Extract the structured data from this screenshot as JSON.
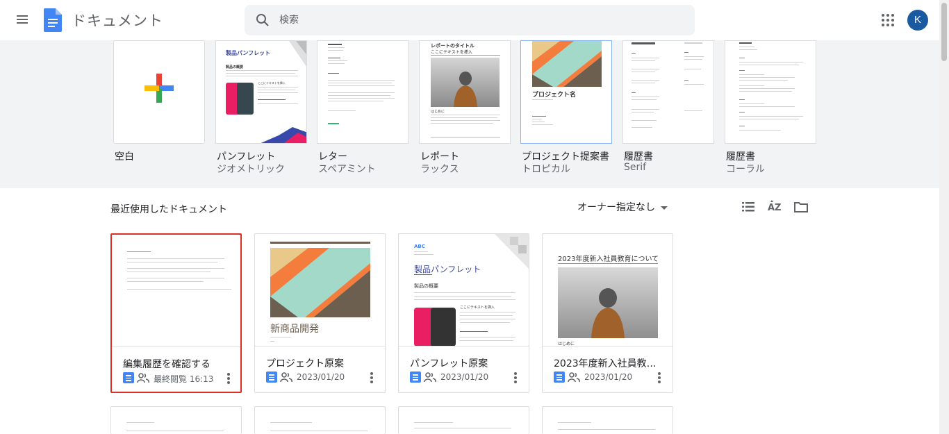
{
  "header": {
    "app_title": "ドキュメント",
    "search_placeholder": "検索",
    "avatar_letter": "K"
  },
  "templates": [
    {
      "name": "空白",
      "sub": ""
    },
    {
      "name": "パンフレット",
      "sub": "ジオメトリック",
      "thumb_title": "製品パンフレット",
      "thumb_sub": "製品の概要",
      "thumb_callout": "ここにテキストを挿入"
    },
    {
      "name": "レター",
      "sub": "スペアミント"
    },
    {
      "name": "レポート",
      "sub": "ラックス",
      "thumb_title": "レポートのタイトル",
      "thumb_sub": "ここにテキストを挿入",
      "thumb_section": "はじめに"
    },
    {
      "name": "プロジェクト提案書",
      "sub": "トロピカル",
      "thumb_title": "プロジェクト名"
    },
    {
      "name": "履歴書",
      "sub": "Serif"
    },
    {
      "name": "履歴書",
      "sub": "コーラル"
    }
  ],
  "recent": {
    "title": "最近使用したドキュメント",
    "owner_filter": "オーナー指定なし"
  },
  "cards": [
    {
      "title": "編集履歴を確認する",
      "date": "最終閲覧 16:13"
    },
    {
      "title": "プロジェクト原案",
      "date": "2023/01/20",
      "preview_title": "新商品開発"
    },
    {
      "title": "パンフレット原案",
      "date": "2023/01/20",
      "preview_brand": "ABC",
      "preview_title": "製品パンフレット",
      "preview_sub": "製品の概要",
      "preview_callout": "ここにテキストを挿入"
    },
    {
      "title": "2023年度新入社員教育に...",
      "date": "2023/01/20",
      "preview_title": "2023年度新入社員教育について",
      "preview_section": "はじめに"
    }
  ],
  "colors": {
    "accent_blue": "#4285f4",
    "avatar": "#1a5aa0",
    "selected_border": "#d93025",
    "band_bg": "#f1f3f4"
  }
}
